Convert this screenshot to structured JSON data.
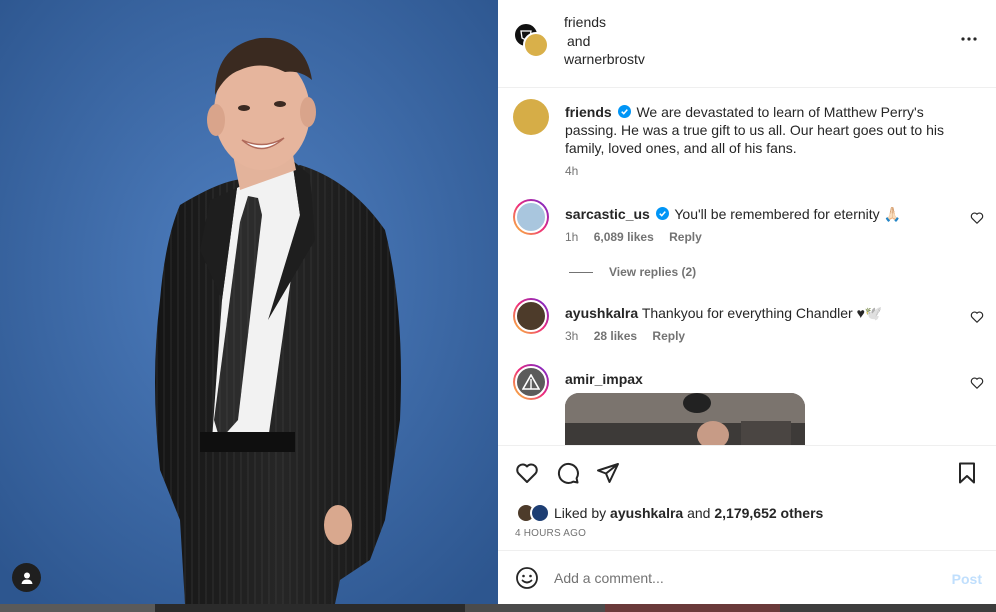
{
  "header": {
    "account1": "friends",
    "joiner": "and",
    "account2": "warnerbrostv"
  },
  "caption": {
    "username": "friends",
    "text": "We are devastated to learn of Matthew Perry's passing. He was a true gift to us all. Our heart goes out to his family, loved ones, and all of his fans.",
    "time": "4h"
  },
  "comments": [
    {
      "username": "sarcastic_us",
      "text": "You'll be remembered for eternity 🙏🏻",
      "time": "1h",
      "likes": "6,089 likes",
      "reply": "Reply",
      "view_replies": "View replies (2)"
    },
    {
      "username": "ayushkalra",
      "text": "Thankyou for everything Chandler ♥🕊️",
      "time": "3h",
      "likes": "28 likes",
      "reply": "Reply"
    },
    {
      "username": "amir_impax"
    }
  ],
  "likes": {
    "prefix": "Liked by",
    "liker": "ayushkalra",
    "joiner": "and",
    "others": "2,179,652 others"
  },
  "timestamp": "4 HOURS AGO",
  "composer": {
    "placeholder": "Add a comment...",
    "post_label": "Post"
  },
  "icons": {
    "header_more": "more-horizontal-icon",
    "verified": "verified-badge-icon",
    "like": "heart-icon",
    "comment": "comment-icon",
    "share": "share-icon",
    "save": "bookmark-icon",
    "emoji": "emoji-icon",
    "user_tag": "user-tag-icon"
  },
  "colors": {
    "verified_blue": "#0095f6",
    "post_disabled": "#c0dffd",
    "muted_text": "#737373"
  }
}
